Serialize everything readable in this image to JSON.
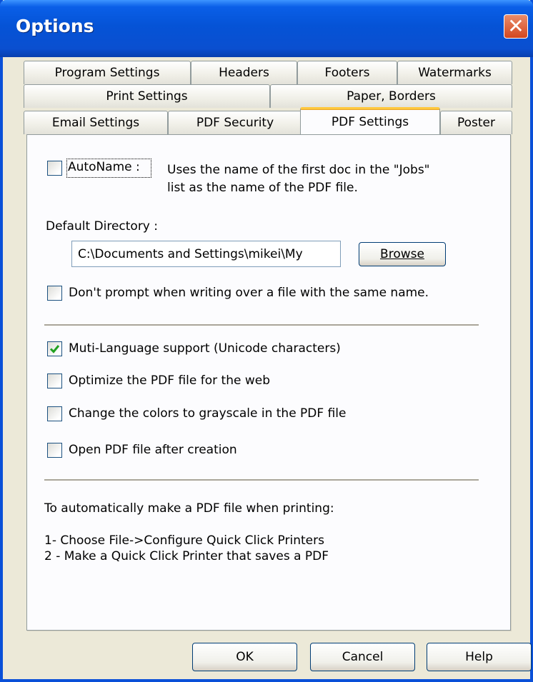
{
  "window": {
    "title": "Options"
  },
  "tabs": {
    "row1": [
      "Program Settings",
      "Headers",
      "Footers",
      "Watermarks"
    ],
    "row2": [
      "Print Settings",
      "Paper, Borders"
    ],
    "row3": [
      "Email Settings",
      "PDF Security",
      "PDF Settings",
      "Poster"
    ],
    "active": "PDF Settings"
  },
  "pdf_settings": {
    "autoname": {
      "label": "AutoName :",
      "checked": false
    },
    "autoname_description": [
      "Uses the name of the first doc in the \"Jobs\"",
      "list as the name of the PDF file."
    ],
    "default_directory_label": "Default Directory :",
    "default_directory_value": "C:\\Documents and Settings\\mikei\\My",
    "browse_label": "Browse",
    "dont_prompt": {
      "label": "Don't prompt when writing over a file with the same name.",
      "checked": false
    },
    "multi_language": {
      "label": "Muti-Language support (Unicode characters)",
      "checked": true
    },
    "optimize_web": {
      "label": "Optimize the PDF file for the web",
      "checked": false
    },
    "grayscale": {
      "label": "Change the colors to grayscale in the PDF file",
      "checked": false
    },
    "open_after": {
      "label": "Open PDF file after creation",
      "checked": false
    },
    "info": {
      "heading": "To automatically make a PDF file when printing:",
      "step1": "1- Choose File->Configure Quick Click Printers",
      "step2": "2 - Make a Quick Click Printer that saves a PDF"
    }
  },
  "buttons": {
    "ok": "OK",
    "cancel": "Cancel",
    "help": "Help"
  }
}
